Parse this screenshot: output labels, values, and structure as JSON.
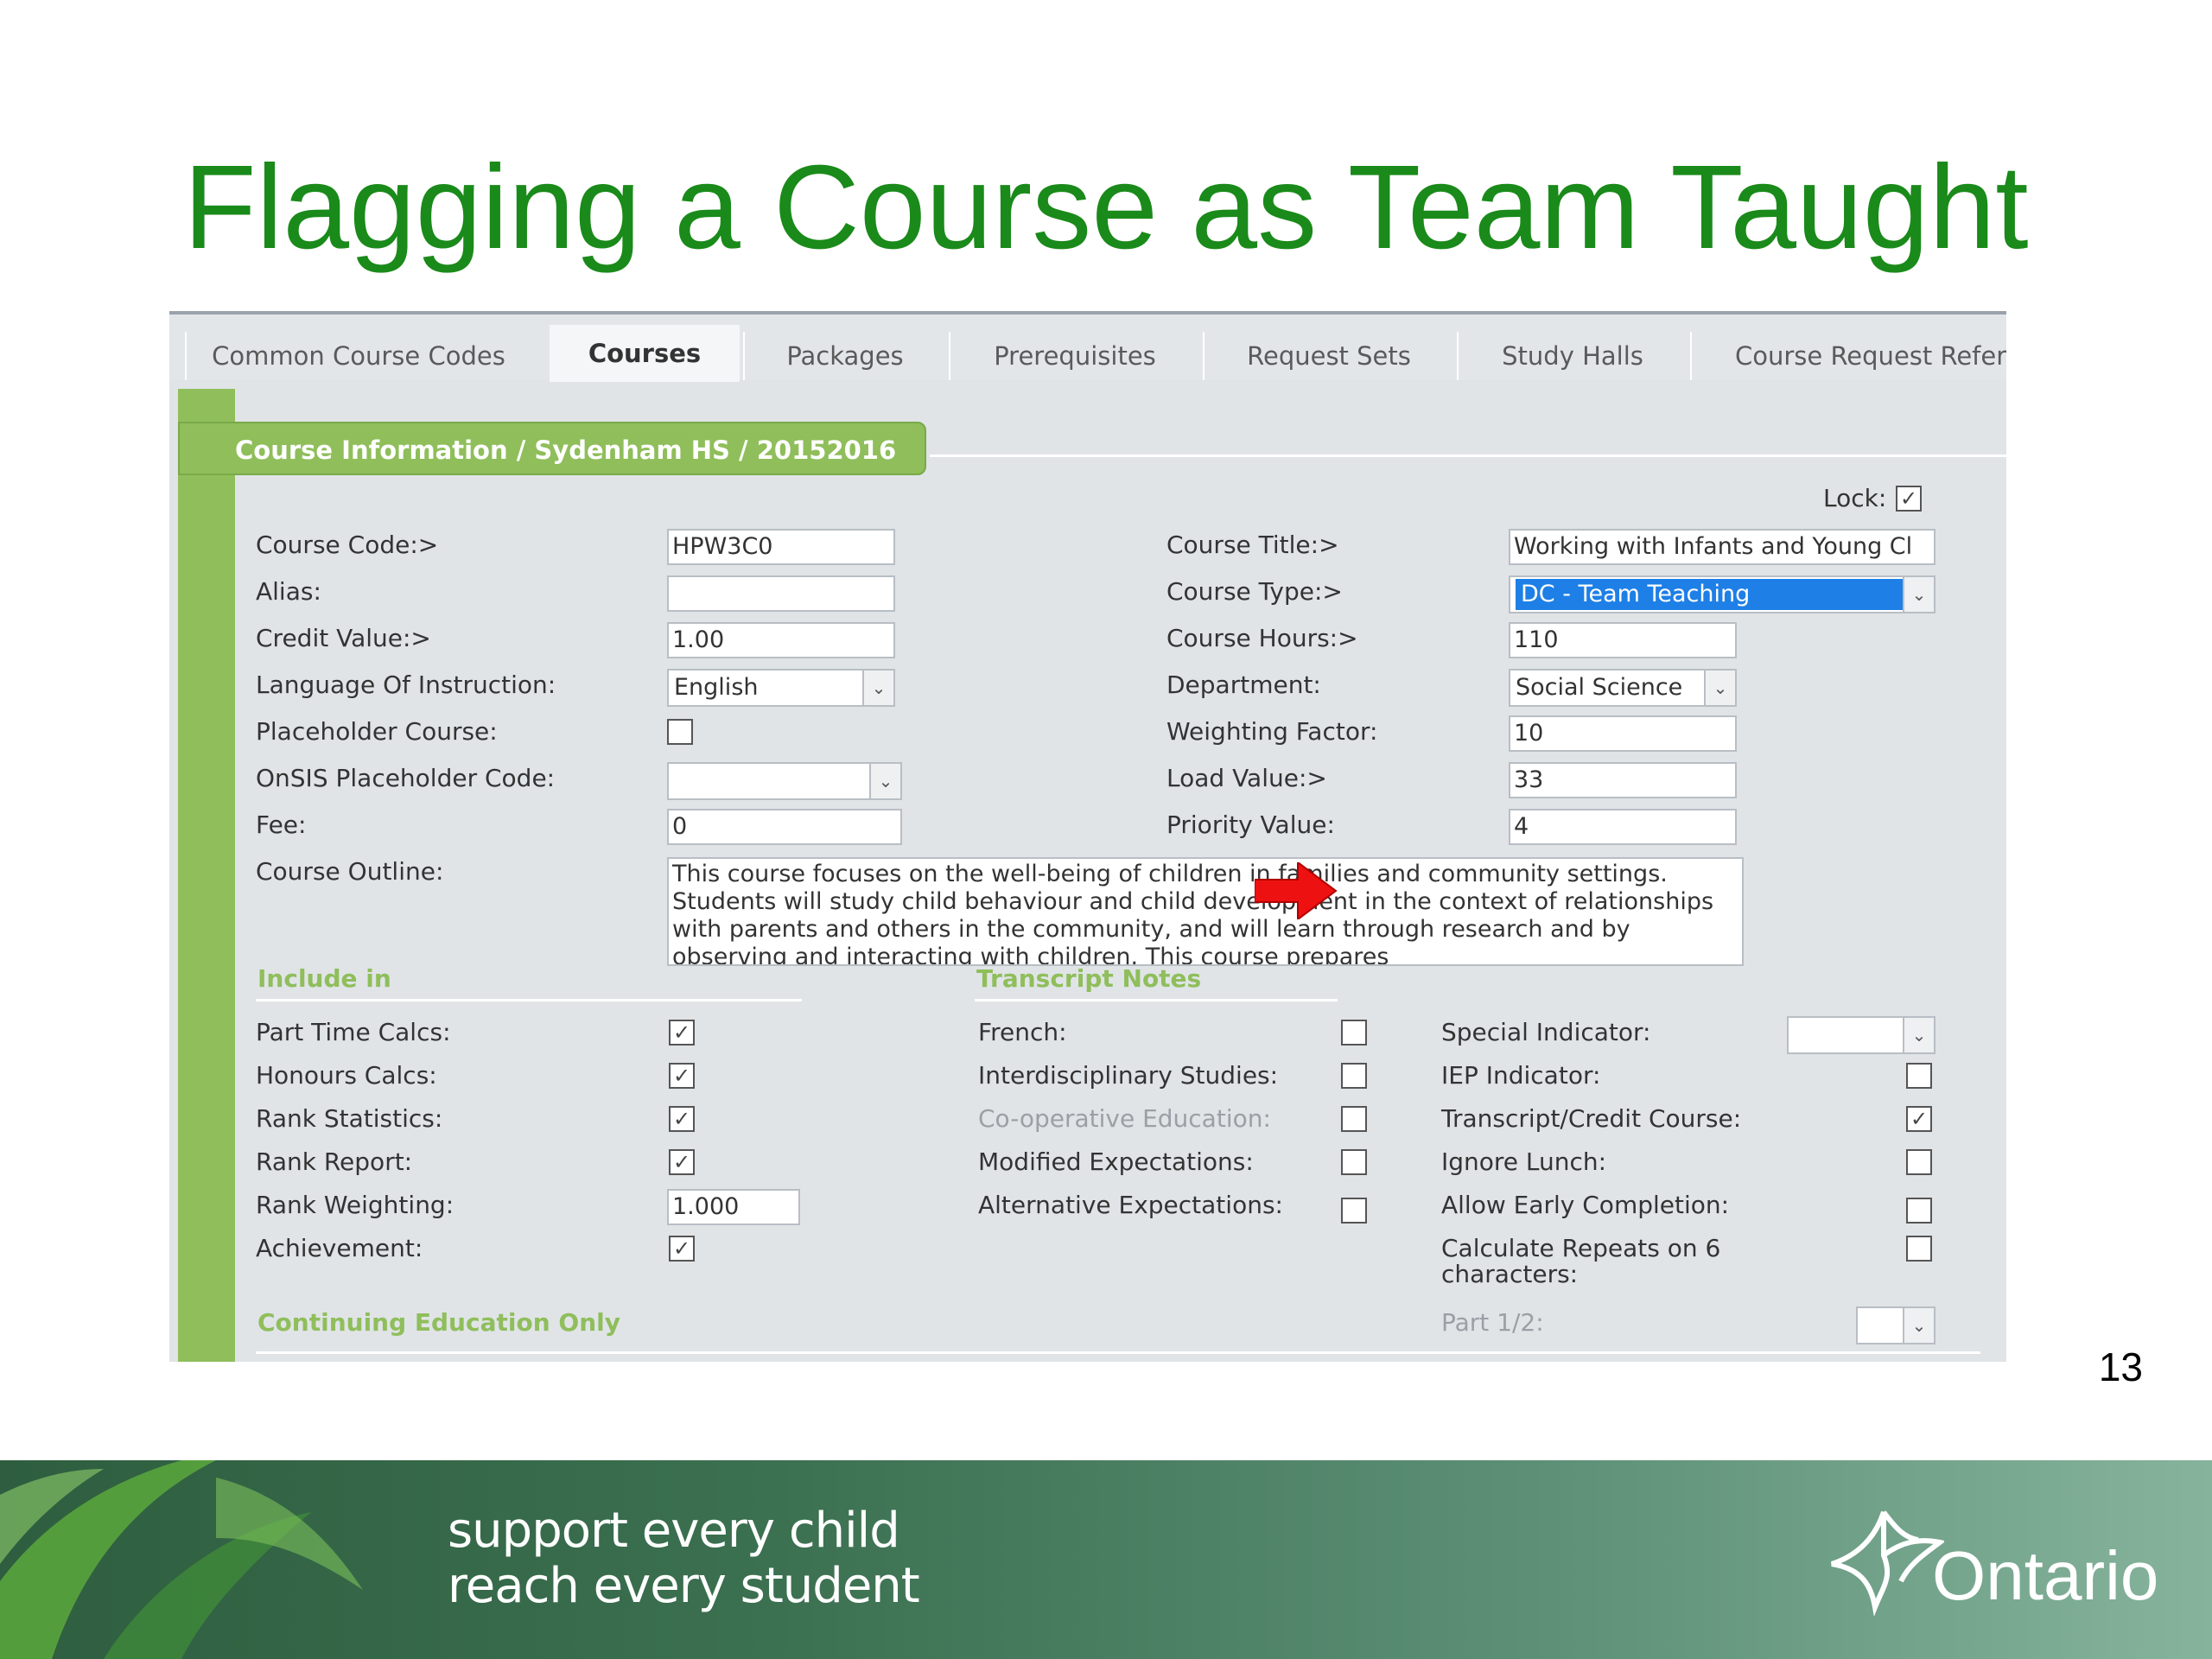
{
  "slide": {
    "title": "Flagging a Course as Team Taught",
    "page_number": "13"
  },
  "tabs": [
    "Common Course Codes",
    "Courses",
    "Packages",
    "Prerequisites",
    "Request Sets",
    "Study Halls",
    "Course Request Refer"
  ],
  "active_tab": "Courses",
  "section_header": "Course Information  / Sydenham HS / 20152016",
  "lock": {
    "label": "Lock:",
    "checked": true
  },
  "left_fields": {
    "course_code_label": "Course Code:>",
    "course_code": "HPW3C0",
    "alias_label": "Alias:",
    "alias": "",
    "credit_value_label": "Credit Value:>",
    "credit_value": "1.00",
    "language_label": "Language Of Instruction:",
    "language": "English",
    "placeholder_course_label": "Placeholder Course:",
    "onsis_label": "OnSIS Placeholder Code:",
    "onsis": "",
    "fee_label": "Fee:",
    "fee": "0",
    "course_outline_label": "Course Outline:",
    "course_outline": "This course focuses on the well-being of children in families and community settings. Students will study child behaviour and child development in the context of relationships with parents and others in the community, and will learn through research and by observing and interacting with children. This course prepares"
  },
  "right_fields": {
    "course_title_label": "Course Title:>",
    "course_title": "Working with Infants and Young Cl",
    "course_type_label": "Course Type:>",
    "course_type": "DC - Team Teaching",
    "course_hours_label": "Course Hours:>",
    "course_hours": "110",
    "department_label": "Department:",
    "department": "Social Science",
    "weighting_label": "Weighting Factor:",
    "weighting": "10",
    "load_label": "Load Value:>",
    "load": "33",
    "priority_label": "Priority Value:",
    "priority": "4"
  },
  "include_in": {
    "heading": "Include in",
    "part_time": "Part Time Calcs:",
    "honours": "Honours Calcs:",
    "rank_stats": "Rank Statistics:",
    "rank_report": "Rank Report:",
    "rank_weighting": "Rank Weighting:",
    "rank_weighting_value": "1.000",
    "achievement": "Achievement:"
  },
  "transcript_notes": {
    "heading": "Transcript Notes",
    "french": "French:",
    "interdisciplinary": "Interdisciplinary Studies:",
    "coop": "Co-operative Education:",
    "modified": "Modified Expectations:",
    "alternative": "Alternative Expectations:"
  },
  "indicators": {
    "special": "Special Indicator:",
    "iep": "IEP Indicator:",
    "transcript_credit": "Transcript/Credit Course:",
    "ignore_lunch": "Ignore Lunch:",
    "early_completion": "Allow Early Completion:",
    "repeats_line1": "Calculate Repeats on 6",
    "repeats_line2": "characters:"
  },
  "continuing": {
    "heading": "Continuing Education Only",
    "part_label": "Part 1/2:"
  },
  "checkmark": "✓",
  "dropdown_glyph": "⌄",
  "footer": {
    "slogan_line1": "support every child",
    "slogan_line2": "reach every student",
    "brand": "Ontario"
  },
  "colors": {
    "title_green": "#1a8a1a",
    "accent_green": "#8fbe5b",
    "highlight_blue": "#1e7fe6",
    "arrow_red": "#ee1111"
  }
}
